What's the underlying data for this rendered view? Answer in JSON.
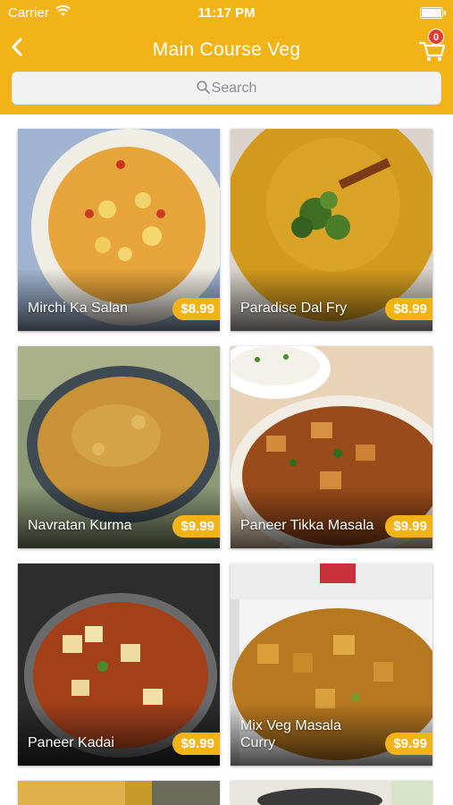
{
  "status_bar": {
    "carrier": "Carrier",
    "time": "11:17 PM"
  },
  "header": {
    "title": "Main Course Veg",
    "cart_count": "0"
  },
  "search": {
    "placeholder": "Search"
  },
  "items": [
    {
      "name": "Mirchi Ka Salan",
      "price": "$8.99"
    },
    {
      "name": "Paradise Dal Fry",
      "price": "$8.99"
    },
    {
      "name": "Navratan Kurma",
      "price": "$9.99"
    },
    {
      "name": "Paneer Tikka Masala",
      "price": "$9.99"
    },
    {
      "name": "Paneer Kadai",
      "price": "$9.99"
    },
    {
      "name": "Mix Veg Masala Curry",
      "price": "$9.99"
    }
  ],
  "colors": {
    "brand": "#f2b317",
    "badge": "#e53935"
  },
  "icons": [
    "wifi-icon",
    "battery-icon",
    "back-chevron-icon",
    "cart-icon",
    "search-icon"
  ]
}
